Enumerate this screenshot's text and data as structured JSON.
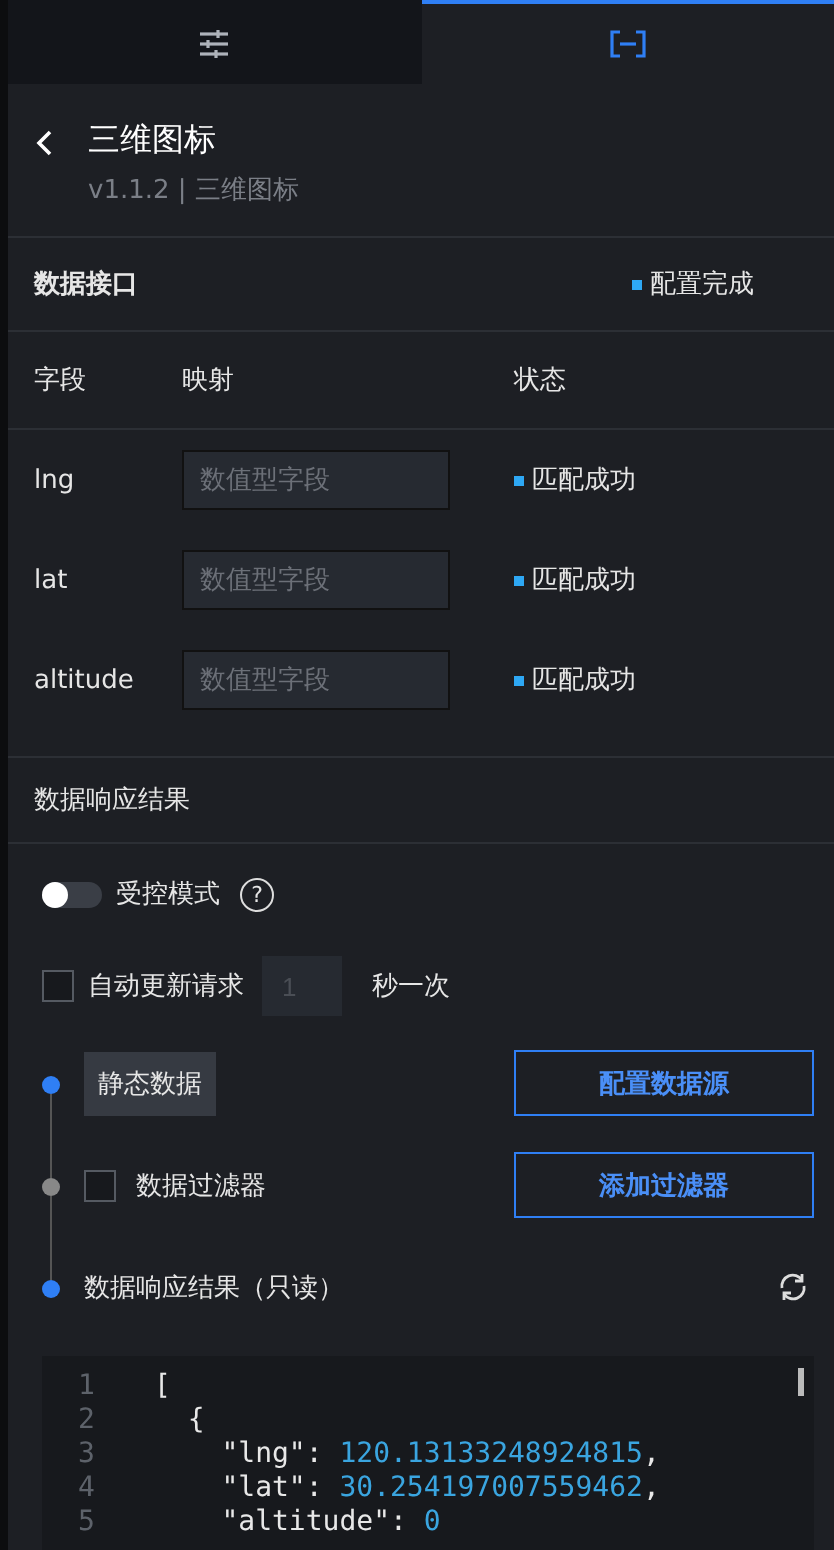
{
  "tabs": [
    {
      "kind": "sliders",
      "selected": false
    },
    {
      "kind": "bracket",
      "selected": true
    }
  ],
  "header": {
    "title": "三维图标",
    "subtitle": "v1.1.2 | 三维图标"
  },
  "interface": {
    "title": "数据接口",
    "status": "配置完成"
  },
  "mapping": {
    "columns": [
      "字段",
      "映射",
      "状态"
    ],
    "rows": [
      {
        "field": "lng",
        "placeholder": "数值型字段",
        "status": "匹配成功"
      },
      {
        "field": "lat",
        "placeholder": "数值型字段",
        "status": "匹配成功"
      },
      {
        "field": "altitude",
        "placeholder": "数值型字段",
        "status": "匹配成功"
      }
    ]
  },
  "response_title": "数据响应结果",
  "controlled": {
    "label": "受控模式",
    "on": false,
    "help": "?"
  },
  "auto_update": {
    "label": "自动更新请求",
    "checked": false,
    "interval": "1",
    "unit": "秒一次"
  },
  "steps": [
    {
      "kind": "source",
      "label": "静态数据",
      "button": "配置数据源",
      "color": "#2f7ff5"
    },
    {
      "kind": "filter",
      "label": "数据过滤器",
      "checked": false,
      "button": "添加过滤器",
      "color": "#888888"
    },
    {
      "kind": "result",
      "label": "数据响应结果（只读）",
      "color": "#2f7ff5"
    }
  ],
  "code": [
    {
      "number": "1",
      "parts": [
        {
          "kind": "plain",
          "text": "["
        }
      ]
    },
    {
      "number": "2",
      "parts": [
        {
          "kind": "plain",
          "text": "  {"
        }
      ]
    },
    {
      "number": "3",
      "parts": [
        {
          "kind": "plain",
          "text": "    \"lng\": "
        },
        {
          "kind": "number",
          "text": "120.13133248924815"
        },
        {
          "kind": "plain",
          "text": ","
        }
      ]
    },
    {
      "number": "4",
      "parts": [
        {
          "kind": "plain",
          "text": "    \"lat\": "
        },
        {
          "kind": "number",
          "text": "30.254197007559462"
        },
        {
          "kind": "plain",
          "text": ","
        }
      ]
    },
    {
      "number": "5",
      "parts": [
        {
          "kind": "plain",
          "text": "    \"altitude\": "
        },
        {
          "kind": "number",
          "text": "0"
        }
      ]
    }
  ]
}
